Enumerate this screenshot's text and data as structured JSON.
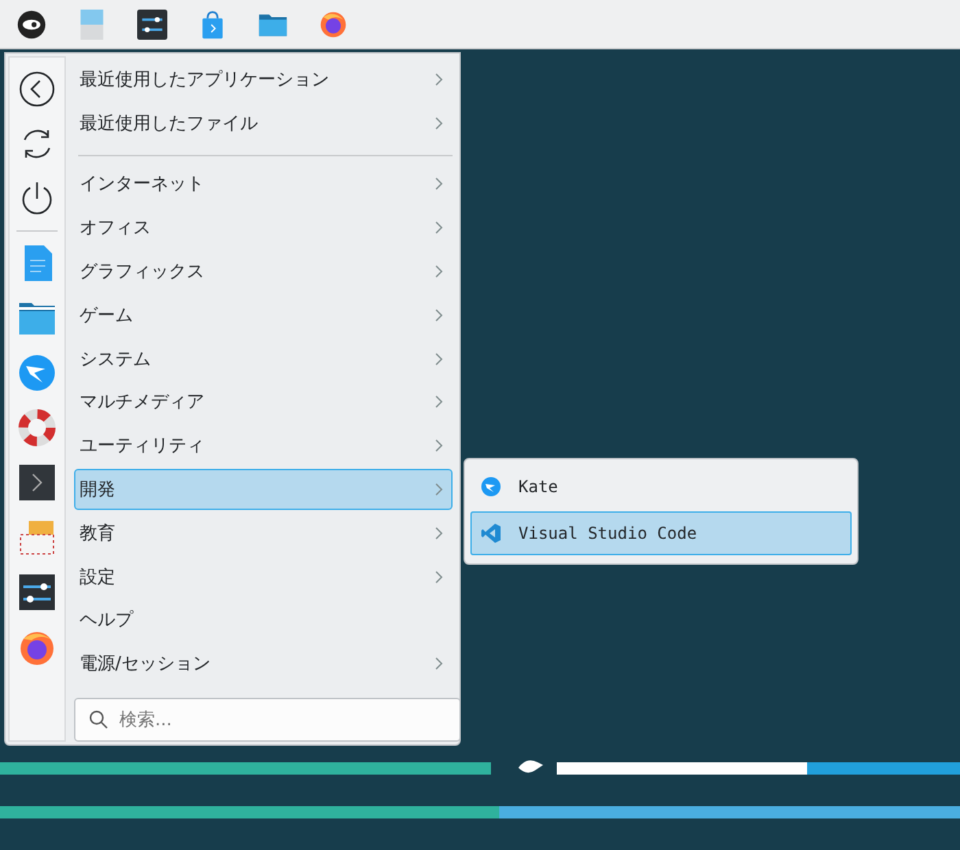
{
  "menu": {
    "items": [
      {
        "kind": "item",
        "label": "最近使用したアプリケーション",
        "submenu": true,
        "selected": false
      },
      {
        "kind": "item",
        "label": "最近使用したファイル",
        "submenu": true,
        "selected": false
      },
      {
        "kind": "separator"
      },
      {
        "kind": "item",
        "label": "インターネット",
        "submenu": true,
        "selected": false
      },
      {
        "kind": "item",
        "label": "オフィス",
        "submenu": true,
        "selected": false
      },
      {
        "kind": "item",
        "label": "グラフィックス",
        "submenu": true,
        "selected": false
      },
      {
        "kind": "item",
        "label": "ゲーム",
        "submenu": true,
        "selected": false
      },
      {
        "kind": "item",
        "label": "システム",
        "submenu": true,
        "selected": false
      },
      {
        "kind": "item",
        "label": "マルチメディア",
        "submenu": true,
        "selected": false
      },
      {
        "kind": "item",
        "label": "ユーティリティ",
        "submenu": true,
        "selected": false
      },
      {
        "kind": "item",
        "label": "開発",
        "submenu": true,
        "selected": true
      },
      {
        "kind": "item",
        "label": "教育",
        "submenu": true,
        "selected": false
      },
      {
        "kind": "item",
        "label": "設定",
        "submenu": true,
        "selected": false
      },
      {
        "kind": "item",
        "label": "ヘルプ",
        "submenu": false,
        "selected": false
      },
      {
        "kind": "item",
        "label": "電源/セッション",
        "submenu": true,
        "selected": false
      }
    ],
    "search": {
      "placeholder": "検索..."
    }
  },
  "submenu": {
    "items": [
      {
        "kind": "kate",
        "label": "Kate",
        "selected": false
      },
      {
        "kind": "vscode",
        "label": "Visual Studio Code",
        "selected": true
      }
    ]
  }
}
